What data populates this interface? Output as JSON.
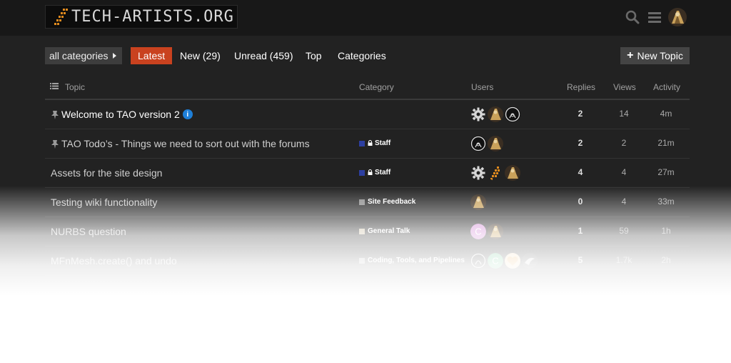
{
  "header": {
    "logo_text": "TECH-ARTISTS.ORG",
    "icons": [
      "search-icon",
      "hamburger-menu-icon"
    ]
  },
  "nav": {
    "category_dropdown": "all categories",
    "items": [
      {
        "label": "Latest",
        "active": true
      },
      {
        "label": "New (29)"
      },
      {
        "label": "Unread (459)"
      },
      {
        "label": "Top"
      },
      {
        "label": "Categories"
      }
    ],
    "new_topic": "New Topic"
  },
  "table": {
    "headers": {
      "topic": "Topic",
      "category": "Category",
      "users": "Users",
      "replies": "Replies",
      "views": "Views",
      "activity": "Activity"
    },
    "rows": [
      {
        "title": "Welcome to TAO version 2",
        "pinned": true,
        "bold": true,
        "info_badge": "i",
        "category": "",
        "category_color": "",
        "locked": false,
        "replies": "2",
        "views": "14",
        "activity": "4m"
      },
      {
        "title": "TAO Todo’s - Things we need to sort out with the forums",
        "pinned": true,
        "bold": false,
        "info_badge": "",
        "category": "Staff",
        "category_color": "#2d3fa0",
        "locked": true,
        "replies": "2",
        "views": "2",
        "activity": "21m"
      },
      {
        "title": "Assets for the site design",
        "pinned": false,
        "bold": false,
        "info_badge": "",
        "category": "Staff",
        "category_color": "#2d3fa0",
        "locked": true,
        "replies": "4",
        "views": "4",
        "activity": "27m"
      },
      {
        "title": "Testing wiki functionality",
        "pinned": false,
        "bold": false,
        "info_badge": "",
        "category": "Site Feedback",
        "category_color": "#8a8a8a",
        "locked": false,
        "replies": "0",
        "views": "4",
        "activity": "33m"
      },
      {
        "title": "NURBS question",
        "pinned": false,
        "bold": false,
        "info_badge": "",
        "category": "General Talk",
        "category_color": "#c8bca0",
        "locked": false,
        "replies": "1",
        "views": "59",
        "activity": "1h"
      },
      {
        "title": "MFnMesh.create() and undo",
        "pinned": false,
        "bold": false,
        "info_badge": "",
        "category": "Coding, Tools, and Pipelines",
        "category_color": "#a0a0a0",
        "locked": false,
        "replies": "5",
        "views": "1.7k",
        "activity": "2h"
      }
    ]
  },
  "colors": {
    "accent": "#c9421f",
    "background": "#222222",
    "header": "#181818"
  }
}
